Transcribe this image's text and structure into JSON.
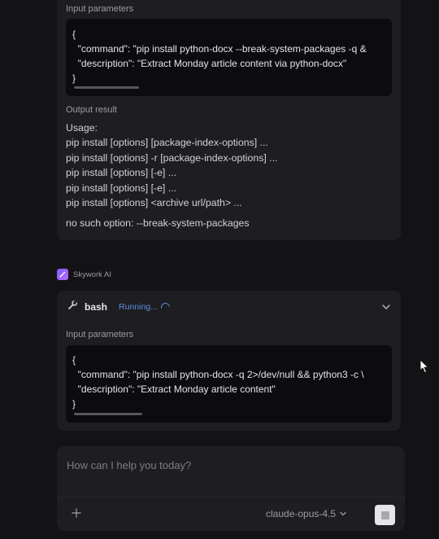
{
  "top_card": {
    "input_label": "Input parameters",
    "code_lines": [
      "{",
      "  \"command\": \"pip install python-docx --break-system-packages -q &",
      "  \"description\": \"Extract Monday article content via python-docx\"",
      "}"
    ],
    "output_label": "Output result",
    "output_lines": [
      "Usage:",
      "pip install [options] [package-index-options] ...",
      "pip install [options] -r [package-index-options] ...",
      "pip install [options] [-e] ...",
      "pip install [options] [-e] ...",
      "pip install [options] <archive url/path> ...",
      "no such option: --break-system-packages"
    ]
  },
  "agent": {
    "name": "Skywork AI",
    "logo_icon": "wand-icon"
  },
  "bash_card": {
    "tool_name": "bash",
    "status": "Running...",
    "input_label": "Input parameters",
    "code_lines": [
      "{",
      "  \"command\": \"pip install python-docx -q 2>/dev/null && python3 -c \\",
      "  \"description\": \"Extract Monday article content\"",
      "}"
    ]
  },
  "composer": {
    "placeholder": "How can I help you today?",
    "model": "claude-opus-4.5",
    "add_icon": "plus-icon",
    "stop_icon": "stop-icon"
  },
  "colors": {
    "background": "#131316",
    "card": "#1e1e22",
    "code_bg": "#0c0c0e",
    "running": "#5b8fe0",
    "accent": "#8b5cf6"
  }
}
